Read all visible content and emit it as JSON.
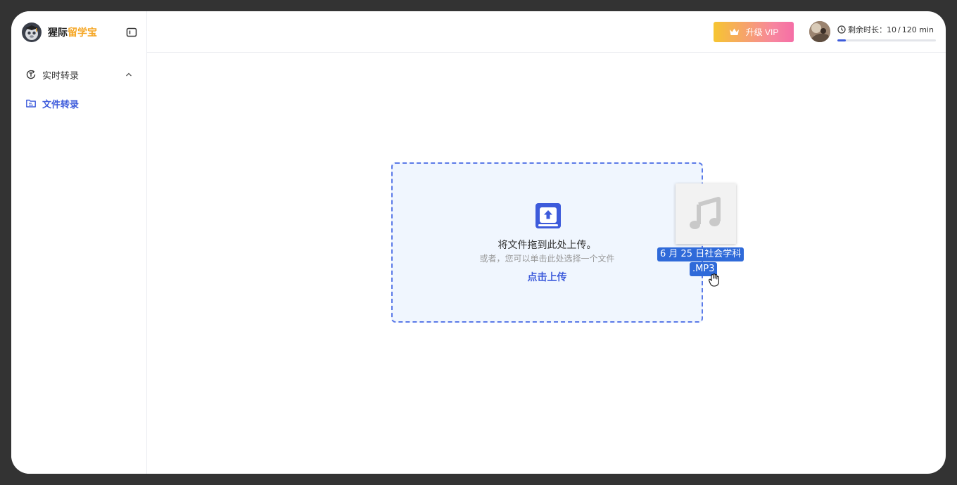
{
  "brand": {
    "name_part1": "猩际",
    "name_part2": "留学宝",
    "accent_color": "#f5a623"
  },
  "sidebar": {
    "items": [
      {
        "label": "实时转录",
        "icon": "realtime-transcribe-icon",
        "expanded": true
      },
      {
        "label": "文件转录",
        "icon": "folder-icon",
        "active": true
      }
    ]
  },
  "header": {
    "vip_label": "升级 VIP",
    "remaining_label": "剩余时长：",
    "remaining_used": "10",
    "remaining_sep": "/",
    "remaining_total": "120 min",
    "remaining_fraction": 0.083
  },
  "upload": {
    "title": "将文件拖到此处上传。",
    "subtitle": "或者，您可以单击此处选择一个文件",
    "link_label": "点击上传",
    "accent_color": "#3d5bdb"
  },
  "drag_file": {
    "name_line1": "6 月 25 日社会学科",
    "name_line2": ".MP3",
    "icon": "music-note-icon"
  }
}
